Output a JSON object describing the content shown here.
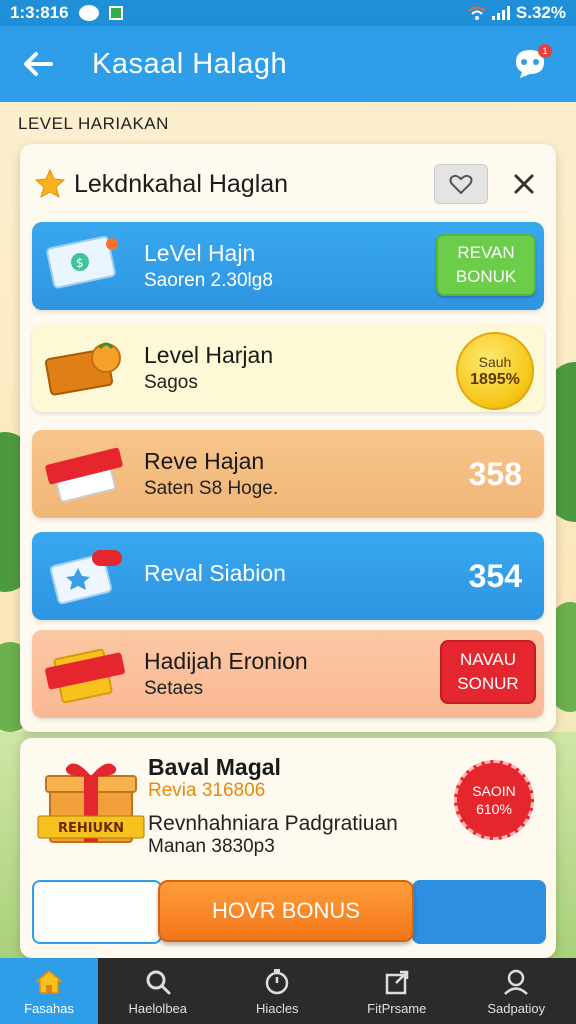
{
  "status_bar": {
    "time": "1:3:816",
    "battery": "S.32%"
  },
  "app_bar": {
    "title": "Kasaal Halagh",
    "badge": "1"
  },
  "section_label": "LEVEL HARIAKAN",
  "panel": {
    "title": "Lekdnkahal Haglan",
    "rows": [
      {
        "title": "LeVel Hajn",
        "sub": "Saoren 2.30lg8",
        "button": [
          "REVAN",
          "BONUK"
        ]
      },
      {
        "title": "Level Harjan",
        "sub": "Sagos",
        "coin": [
          "Sauh",
          "1895%"
        ]
      },
      {
        "title": "Reve Hajan",
        "sub": "Saten S8 Hoge.",
        "value": "358"
      },
      {
        "title": "Reval Siabion",
        "sub": "",
        "value": "354"
      },
      {
        "title": "Hadijah Eronion",
        "sub": "Setaes",
        "button": [
          "NAVAU",
          "SONUR"
        ]
      }
    ]
  },
  "reward": {
    "title": "Baval Magal",
    "subtitle": "Revia 316806",
    "desc": "Revnhahniara Padgratiuan",
    "desc2": "Manan 3830p3",
    "badge": [
      "SAOIN",
      "610%"
    ],
    "gift_label": "REHIUKN",
    "button": "HOVR BONUS"
  },
  "nav": {
    "items": [
      {
        "label": "Fasahas",
        "icon": "home-icon"
      },
      {
        "label": "Haelolbea",
        "icon": "search-icon"
      },
      {
        "label": "Hiacles",
        "icon": "timer-icon"
      },
      {
        "label": "FitPrsame",
        "icon": "share-icon"
      },
      {
        "label": "Sadpatioy",
        "icon": "profile-icon"
      }
    ]
  },
  "colors": {
    "primary": "#2e9ee8",
    "green": "#6ccd4b",
    "red": "#e6262e",
    "orange": "#f2761a"
  }
}
